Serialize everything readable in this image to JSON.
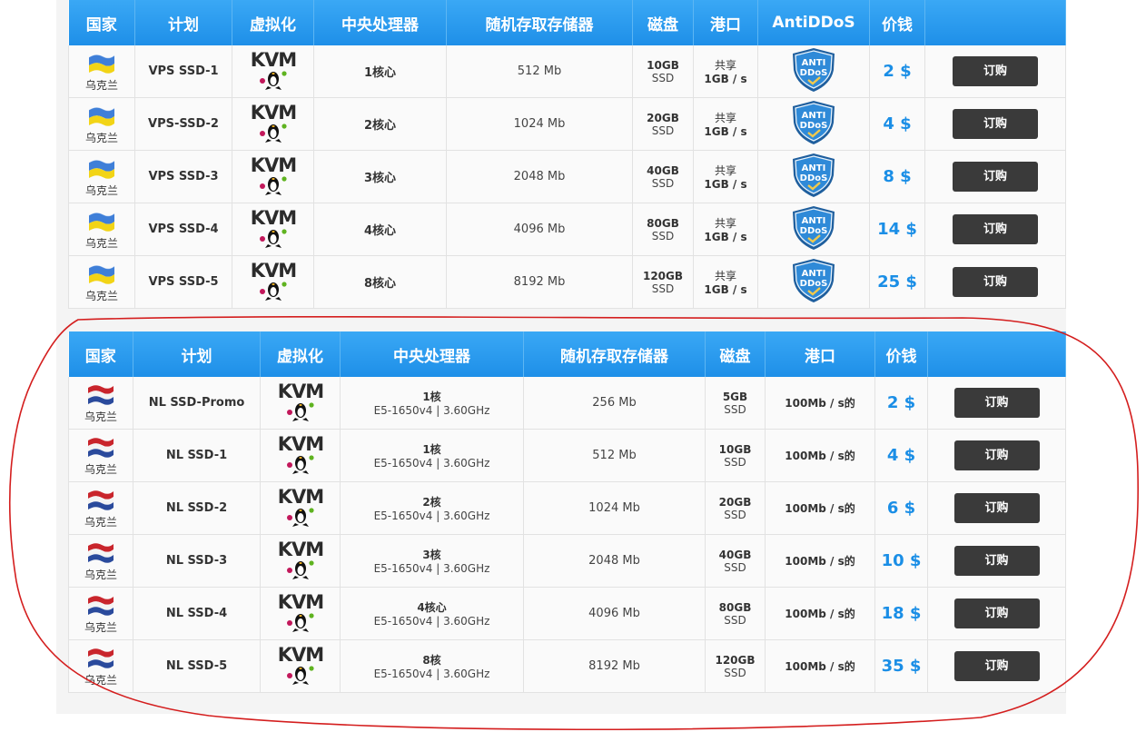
{
  "colors": {
    "header_bg": "#2196f3",
    "price": "#1a8ee6",
    "button_bg": "#3a3a3a",
    "annotation": "#d41e1e"
  },
  "table1": {
    "headers": {
      "country": "国家",
      "plan": "计划",
      "virt": "虚拟化",
      "cpu": "中央处理器",
      "ram": "随机存取存储器",
      "disk": "磁盘",
      "port": "港口",
      "ddos": "AntiDDoS",
      "price": "价钱"
    },
    "rows": [
      {
        "country": "乌克兰",
        "plan": "VPS SSD-1",
        "cpu": "1核心",
        "ram": "512 Mb",
        "disk_size": "10GB",
        "disk_type": "SSD",
        "port_a": "共享",
        "port_b": "1GB / s",
        "ddos_label": "ANTI DDoS",
        "price": "2 $",
        "order": "订购"
      },
      {
        "country": "乌克兰",
        "plan": "VPS-SSD-2",
        "cpu": "2核心",
        "ram": "1024 Mb",
        "disk_size": "20GB",
        "disk_type": "SSD",
        "port_a": "共享",
        "port_b": "1GB / s",
        "ddos_label": "ANTI DDoS",
        "price": "4 $",
        "order": "订购"
      },
      {
        "country": "乌克兰",
        "plan": "VPS SSD-3",
        "cpu": "3核心",
        "ram": "2048 Mb",
        "disk_size": "40GB",
        "disk_type": "SSD",
        "port_a": "共享",
        "port_b": "1GB / s",
        "ddos_label": "ANTI DDoS",
        "price": "8 $",
        "order": "订购"
      },
      {
        "country": "乌克兰",
        "plan": "VPS SSD-4",
        "cpu": "4核心",
        "ram": "4096 Mb",
        "disk_size": "80GB",
        "disk_type": "SSD",
        "port_a": "共享",
        "port_b": "1GB / s",
        "ddos_label": "ANTI DDoS",
        "price": "14 $",
        "order": "订购"
      },
      {
        "country": "乌克兰",
        "plan": "VPS SSD-5",
        "cpu": "8核心",
        "ram": "8192 Mb",
        "disk_size": "120GB",
        "disk_type": "SSD",
        "port_a": "共享",
        "port_b": "1GB / s",
        "ddos_label": "ANTI DDoS",
        "price": "25 $",
        "order": "订购"
      }
    ]
  },
  "table2": {
    "headers": {
      "country": "国家",
      "plan": "计划",
      "virt": "虚拟化",
      "cpu": "中央处理器",
      "ram": "随机存取存储器",
      "disk": "磁盘",
      "port": "港口",
      "price": "价钱"
    },
    "rows": [
      {
        "country": "乌克兰",
        "plan": "NL SSD-Promo",
        "cpu_main": "1核",
        "cpu_sub": "E5-1650v4 | 3.60GHz",
        "ram": "256 Mb",
        "disk_size": "5GB",
        "disk_type": "SSD",
        "port": "100Mb / s的",
        "price": "2 $",
        "order": "订购"
      },
      {
        "country": "乌克兰",
        "plan": "NL SSD-1",
        "cpu_main": "1核",
        "cpu_sub": "E5-1650v4 | 3.60GHz",
        "ram": "512 Mb",
        "disk_size": "10GB",
        "disk_type": "SSD",
        "port": "100Mb / s的",
        "price": "4 $",
        "order": "订购"
      },
      {
        "country": "乌克兰",
        "plan": "NL SSD-2",
        "cpu_main": "2核",
        "cpu_sub": "E5-1650v4 | 3.60GHz",
        "ram": "1024 Mb",
        "disk_size": "20GB",
        "disk_type": "SSD",
        "port": "100Mb / s的",
        "price": "6 $",
        "order": "订购"
      },
      {
        "country": "乌克兰",
        "plan": "NL SSD-3",
        "cpu_main": "3核",
        "cpu_sub": "E5-1650v4 | 3.60GHz",
        "ram": "2048 Mb",
        "disk_size": "40GB",
        "disk_type": "SSD",
        "port": "100Mb / s的",
        "price": "10 $",
        "order": "订购"
      },
      {
        "country": "乌克兰",
        "plan": "NL SSD-4",
        "cpu_main": "4核心",
        "cpu_sub": "E5-1650v4 | 3.60GHz",
        "ram": "4096 Mb",
        "disk_size": "80GB",
        "disk_type": "SSD",
        "port": "100Mb / s的",
        "price": "18 $",
        "order": "订购"
      },
      {
        "country": "乌克兰",
        "plan": "NL SSD-5",
        "cpu_main": "8核",
        "cpu_sub": "E5-1650v4 | 3.60GHz",
        "ram": "8192 Mb",
        "disk_size": "120GB",
        "disk_type": "SSD",
        "port": "100Mb / s的",
        "price": "35 $",
        "order": "订购"
      }
    ]
  },
  "icons": {
    "flag_table1": "ukraine-flag-icon",
    "flag_table2": "netherlands-flag-icon",
    "virtualization": "kvm-logo",
    "ddos": "anti-ddos-shield-icon"
  }
}
